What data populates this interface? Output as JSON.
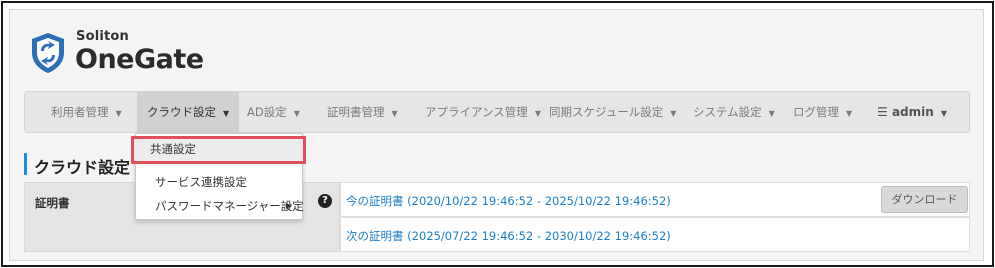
{
  "logo": {
    "small_text": "Soliton",
    "big_text": "OneGate",
    "icon": "shield-logo-icon"
  },
  "nav": {
    "items": [
      {
        "label": "利用者管理"
      },
      {
        "label": "クラウド設定"
      },
      {
        "label": "AD設定"
      },
      {
        "label": "証明書管理"
      },
      {
        "label": "アプライアンス管理"
      },
      {
        "label": "同期スケジュール設定"
      },
      {
        "label": "システム設定"
      },
      {
        "label": "ログ管理"
      },
      {
        "label": "admin"
      }
    ],
    "active_index": 1,
    "menu_icon": "hamburger-icon"
  },
  "dropdown": {
    "items": [
      {
        "label": "共通設定"
      },
      {
        "label": "サービス連携設定"
      },
      {
        "label": "パスワードマネージャー設定"
      }
    ],
    "highlighted_index": 0
  },
  "page": {
    "title": "クラウド設定"
  },
  "table": {
    "label": "証明書",
    "current_cert": "今の証明書 (2020/10/22 19:46:52 - 2025/10/22 19:46:52)",
    "next_cert": "次の証明書 (2025/07/22 19:46:52 - 2030/10/22 19:46:52)",
    "download_label": "ダウンロード",
    "help_icon": "question-circle-icon"
  },
  "colors": {
    "accent": "#1c8dd6",
    "link": "#1d7ec8",
    "highlight_border": "#e0505b",
    "navbar_bg": "#e6e6e6",
    "logo_blue": "#2d6fb7"
  }
}
